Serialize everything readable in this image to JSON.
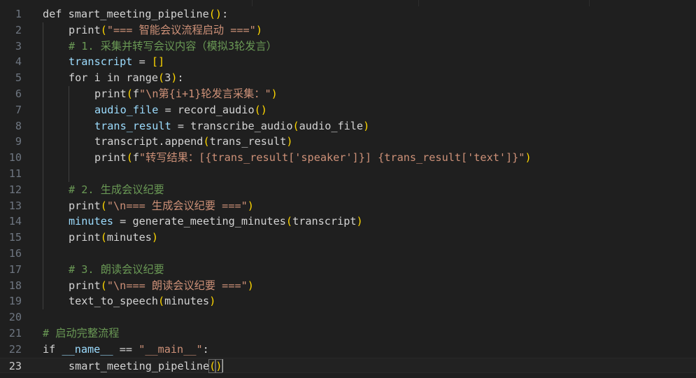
{
  "editor": {
    "current_line": 23,
    "lines": [
      {
        "number": "1",
        "indent": 0,
        "tokens": [
          {
            "t": "def",
            "c": "t-plain"
          },
          {
            "t": " ",
            "c": "t-plain"
          },
          {
            "t": "smart_meeting_pipeline",
            "c": "t-plain"
          },
          {
            "t": "(",
            "c": "t-p1"
          },
          {
            "t": ")",
            "c": "t-p1"
          },
          {
            "t": ":",
            "c": "t-plain"
          }
        ]
      },
      {
        "number": "2",
        "indent": 1,
        "tokens": [
          {
            "t": "print",
            "c": "t-plain"
          },
          {
            "t": "(",
            "c": "t-p1"
          },
          {
            "t": "\"=== 智能会议流程启动 ===\"",
            "c": "t-str"
          },
          {
            "t": ")",
            "c": "t-p1"
          }
        ]
      },
      {
        "number": "3",
        "indent": 1,
        "tokens": [
          {
            "t": "# 1. 采集并转写会议内容（模拟3轮发言）",
            "c": "t-com"
          }
        ]
      },
      {
        "number": "4",
        "indent": 1,
        "tokens": [
          {
            "t": "transcript",
            "c": "t-var"
          },
          {
            "t": " = ",
            "c": "t-op"
          },
          {
            "t": "[",
            "c": "t-p1"
          },
          {
            "t": "]",
            "c": "t-p1"
          }
        ]
      },
      {
        "number": "5",
        "indent": 1,
        "tokens": [
          {
            "t": "for",
            "c": "t-plain"
          },
          {
            "t": " i ",
            "c": "t-plain"
          },
          {
            "t": "in",
            "c": "t-plain"
          },
          {
            "t": " range",
            "c": "t-plain"
          },
          {
            "t": "(",
            "c": "t-p1"
          },
          {
            "t": "3",
            "c": "t-plain"
          },
          {
            "t": ")",
            "c": "t-p1"
          },
          {
            "t": ":",
            "c": "t-plain"
          }
        ]
      },
      {
        "number": "6",
        "indent": 2,
        "tokens": [
          {
            "t": "print",
            "c": "t-plain"
          },
          {
            "t": "(",
            "c": "t-p1"
          },
          {
            "t": "f",
            "c": "t-plain"
          },
          {
            "t": "\"",
            "c": "t-str"
          },
          {
            "t": "\\n",
            "c": "t-str"
          },
          {
            "t": "第",
            "c": "t-str"
          },
          {
            "t": "{i+1}",
            "c": "t-str"
          },
          {
            "t": "轮发言采集：\"",
            "c": "t-str"
          },
          {
            "t": ")",
            "c": "t-p1"
          }
        ]
      },
      {
        "number": "7",
        "indent": 2,
        "tokens": [
          {
            "t": "audio_file",
            "c": "t-var"
          },
          {
            "t": " = ",
            "c": "t-op"
          },
          {
            "t": "record_audio",
            "c": "t-plain"
          },
          {
            "t": "(",
            "c": "t-p1"
          },
          {
            "t": ")",
            "c": "t-p1"
          }
        ]
      },
      {
        "number": "8",
        "indent": 2,
        "tokens": [
          {
            "t": "trans_result",
            "c": "t-var"
          },
          {
            "t": " = ",
            "c": "t-op"
          },
          {
            "t": "transcribe_audio",
            "c": "t-plain"
          },
          {
            "t": "(",
            "c": "t-p1"
          },
          {
            "t": "audio_file",
            "c": "t-plain"
          },
          {
            "t": ")",
            "c": "t-p1"
          }
        ]
      },
      {
        "number": "9",
        "indent": 2,
        "tokens": [
          {
            "t": "transcript.append",
            "c": "t-plain"
          },
          {
            "t": "(",
            "c": "t-p1"
          },
          {
            "t": "trans_result",
            "c": "t-plain"
          },
          {
            "t": ")",
            "c": "t-p1"
          }
        ]
      },
      {
        "number": "10",
        "indent": 2,
        "tokens": [
          {
            "t": "print",
            "c": "t-plain"
          },
          {
            "t": "(",
            "c": "t-p1"
          },
          {
            "t": "f",
            "c": "t-plain"
          },
          {
            "t": "\"转写结果：[{trans_result['speaker']}] {trans_result['text']}\"",
            "c": "t-str"
          },
          {
            "t": ")",
            "c": "t-p1"
          }
        ]
      },
      {
        "number": "11",
        "indent": 2,
        "tokens": []
      },
      {
        "number": "12",
        "indent": 1,
        "tokens": [
          {
            "t": "# 2. 生成会议纪要",
            "c": "t-com"
          }
        ]
      },
      {
        "number": "13",
        "indent": 1,
        "tokens": [
          {
            "t": "print",
            "c": "t-plain"
          },
          {
            "t": "(",
            "c": "t-p1"
          },
          {
            "t": "\"",
            "c": "t-str"
          },
          {
            "t": "\\n",
            "c": "t-str"
          },
          {
            "t": "=== 生成会议纪要 ===\"",
            "c": "t-str"
          },
          {
            "t": ")",
            "c": "t-p1"
          }
        ]
      },
      {
        "number": "14",
        "indent": 1,
        "tokens": [
          {
            "t": "minutes",
            "c": "t-var"
          },
          {
            "t": " = ",
            "c": "t-op"
          },
          {
            "t": "generate_meeting_minutes",
            "c": "t-plain"
          },
          {
            "t": "(",
            "c": "t-p1"
          },
          {
            "t": "transcript",
            "c": "t-plain"
          },
          {
            "t": ")",
            "c": "t-p1"
          }
        ]
      },
      {
        "number": "15",
        "indent": 1,
        "tokens": [
          {
            "t": "print",
            "c": "t-plain"
          },
          {
            "t": "(",
            "c": "t-p1"
          },
          {
            "t": "minutes",
            "c": "t-plain"
          },
          {
            "t": ")",
            "c": "t-p1"
          }
        ]
      },
      {
        "number": "16",
        "indent": 1,
        "tokens": []
      },
      {
        "number": "17",
        "indent": 1,
        "tokens": [
          {
            "t": "# 3. 朗读会议纪要",
            "c": "t-com"
          }
        ]
      },
      {
        "number": "18",
        "indent": 1,
        "tokens": [
          {
            "t": "print",
            "c": "t-plain"
          },
          {
            "t": "(",
            "c": "t-p1"
          },
          {
            "t": "\"",
            "c": "t-str"
          },
          {
            "t": "\\n",
            "c": "t-str"
          },
          {
            "t": "=== 朗读会议纪要 ===\"",
            "c": "t-str"
          },
          {
            "t": ")",
            "c": "t-p1"
          }
        ]
      },
      {
        "number": "19",
        "indent": 1,
        "tokens": [
          {
            "t": "text_to_speech",
            "c": "t-plain"
          },
          {
            "t": "(",
            "c": "t-p1"
          },
          {
            "t": "minutes",
            "c": "t-plain"
          },
          {
            "t": ")",
            "c": "t-p1"
          }
        ]
      },
      {
        "number": "20",
        "indent": 0,
        "tokens": []
      },
      {
        "number": "21",
        "indent": 0,
        "tokens": [
          {
            "t": "# 启动完整流程",
            "c": "t-com"
          }
        ]
      },
      {
        "number": "22",
        "indent": 0,
        "tokens": [
          {
            "t": "if",
            "c": "t-plain"
          },
          {
            "t": " ",
            "c": "t-plain"
          },
          {
            "t": "__name__",
            "c": "t-var"
          },
          {
            "t": " == ",
            "c": "t-op"
          },
          {
            "t": "\"__main__\"",
            "c": "t-str"
          },
          {
            "t": ":",
            "c": "t-plain"
          }
        ]
      },
      {
        "number": "23",
        "indent": 1,
        "tokens": [
          {
            "t": "smart_meeting_pipeline",
            "c": "t-plain"
          },
          {
            "t": "(",
            "c": "t-p1 bm"
          },
          {
            "t": ")",
            "c": "t-p1 bm"
          },
          {
            "t": "",
            "c": "cursor"
          }
        ]
      }
    ]
  }
}
